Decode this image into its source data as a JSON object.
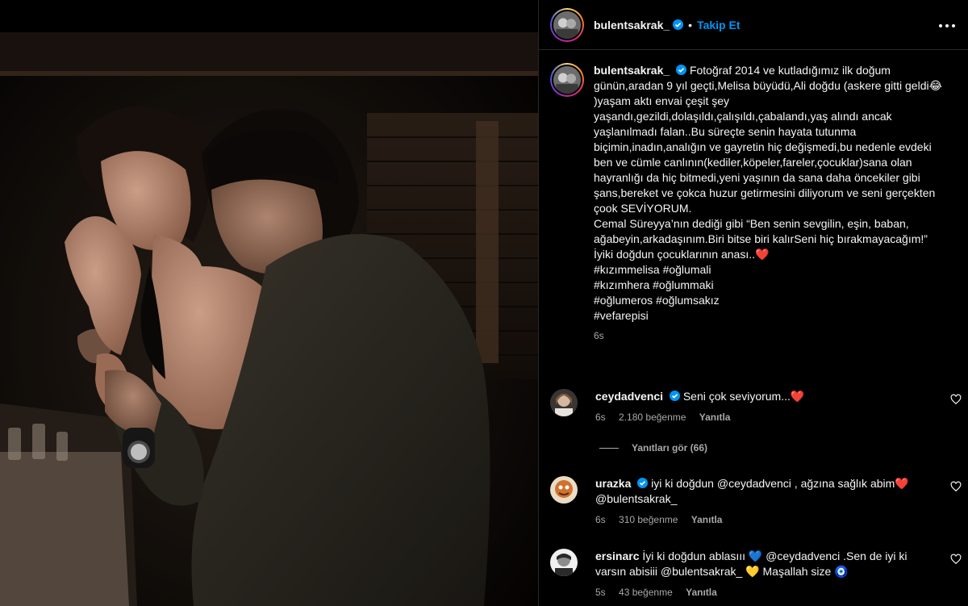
{
  "header": {
    "username": "bulentsakrak_",
    "dot": "•",
    "follow_label": "Takip Et",
    "more_icon": "more-horizontal-icon"
  },
  "caption": {
    "username": "bulentsakrak_",
    "text": "Fotoğraf 2014 ve kutladığımız ilk doğum günün,aradan 9 yıl geçti,Melisa büyüdü,Ali doğdu (askere gitti geldi😂 )yaşam aktı envai çeşit şey yaşandı,gezildi,dolaşıldı,çalışıldı,çabalandı,yaş alındı ancak yaşlanılmadı falan..Bu süreçte senin hayata tutunma biçimin,inadın,analığın ve gayretin hiç değişmedi,bu nedenle evdeki ben ve cümle canlının(kediler,köpeler,fareler,çocuklar)sana olan hayranlığı da hiç bitmedi,yeni yaşının da sana daha öncekiler gibi şans,bereket ve çokca huzur getirmesini diliyorum ve seni gerçekten çook SEVİYORUM.\nCemal Süreyya’nın dediği gibi “Ben senin sevgilin, eşin, baban, ağabeyin,arkadaşınım.Biri bitse biri kalırSeni hiç bırakmayacağım!”\nİyiki doğdun çocuklarının anası..❤️\n#kızımmelisa #oğlumali\n#kızımhera #oğlummaki\n#oğlumeros #oğlumsakız\n#vefarepisi",
    "time": "6s"
  },
  "comments": [
    {
      "username": "ceydadvenci",
      "verified": true,
      "text": "Seni çok seviyorum...❤️",
      "time": "6s",
      "likes": "2.180 beğenme",
      "reply_label": "Yanıtla"
    },
    {
      "username": "urazka",
      "verified": true,
      "text": "iyi ki doğdun @ceydadvenci , ağzına sağlık abim❤️ @bulentsakrak_",
      "time": "6s",
      "likes": "310 beğenme",
      "reply_label": "Yanıtla"
    },
    {
      "username": "ersinarc",
      "verified": false,
      "text": "İyi ki doğdun ablasııı 💙 @ceydadvenci .Sen de iyi ki varsın abisiii @bulentsakrak_ 💛 Maşallah size 🧿",
      "time": "5s",
      "likes": "43 beğenme",
      "reply_label": "Yanıtla"
    }
  ],
  "view_replies_label": "Yanıtları gör (66)",
  "colors": {
    "accent": "#0095f6",
    "verified": "#0095f6",
    "secondary_text": "#a8a8a8",
    "border": "#262626",
    "background": "#000000"
  },
  "icons": {
    "like": "heart-icon",
    "verified": "verified-badge-icon"
  }
}
